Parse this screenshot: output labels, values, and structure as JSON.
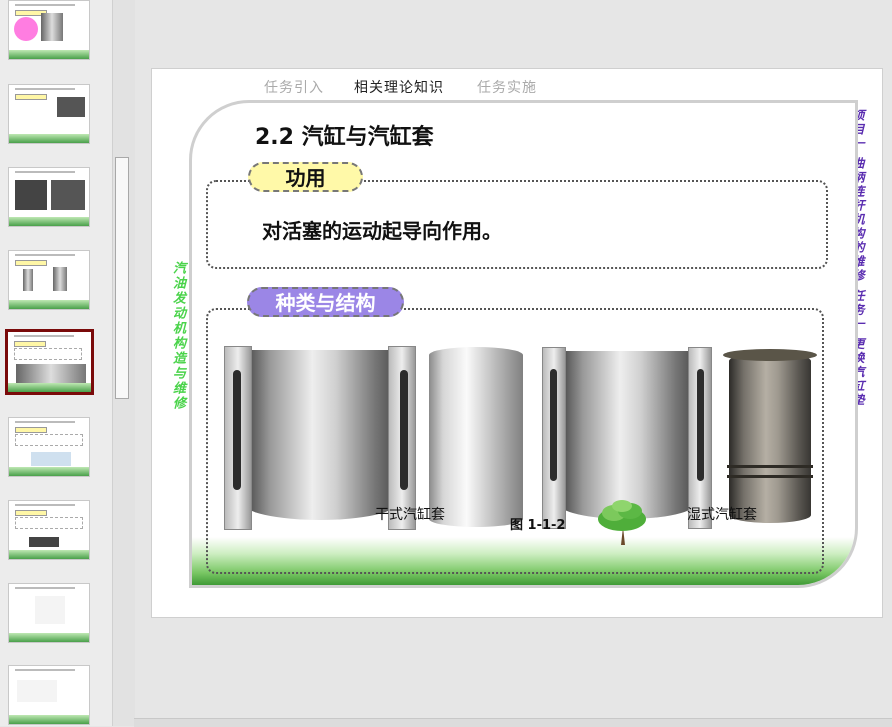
{
  "slide": {
    "nav_tabs": [
      "任务引入",
      "相关理论知识",
      "任务实施"
    ],
    "active_tab_index": 1,
    "left_vertical_title": "汽油发动机构造与维修",
    "right_vertical_title": "项目一 曲柄连杆机构的维修 任务一 更换汽缸垫",
    "section_title": "2.2 汽缸与汽缸套",
    "function_label": "功用",
    "function_text": "对活塞的运动起导向作用。",
    "types_label": "种类与结构",
    "caption_dry": "干式汽缸套",
    "caption_wet": "湿式汽缸套",
    "figure_number": "图 1-1-2"
  },
  "colors": {
    "selected_thumb_border": "#7a0a0a",
    "left_title": "#4ad34a",
    "right_title": "#5a2db0",
    "function_pill": "#fff9a8",
    "types_pill": "#9b86e6"
  },
  "thumbnails": {
    "count": 9,
    "selected_index": 4
  }
}
